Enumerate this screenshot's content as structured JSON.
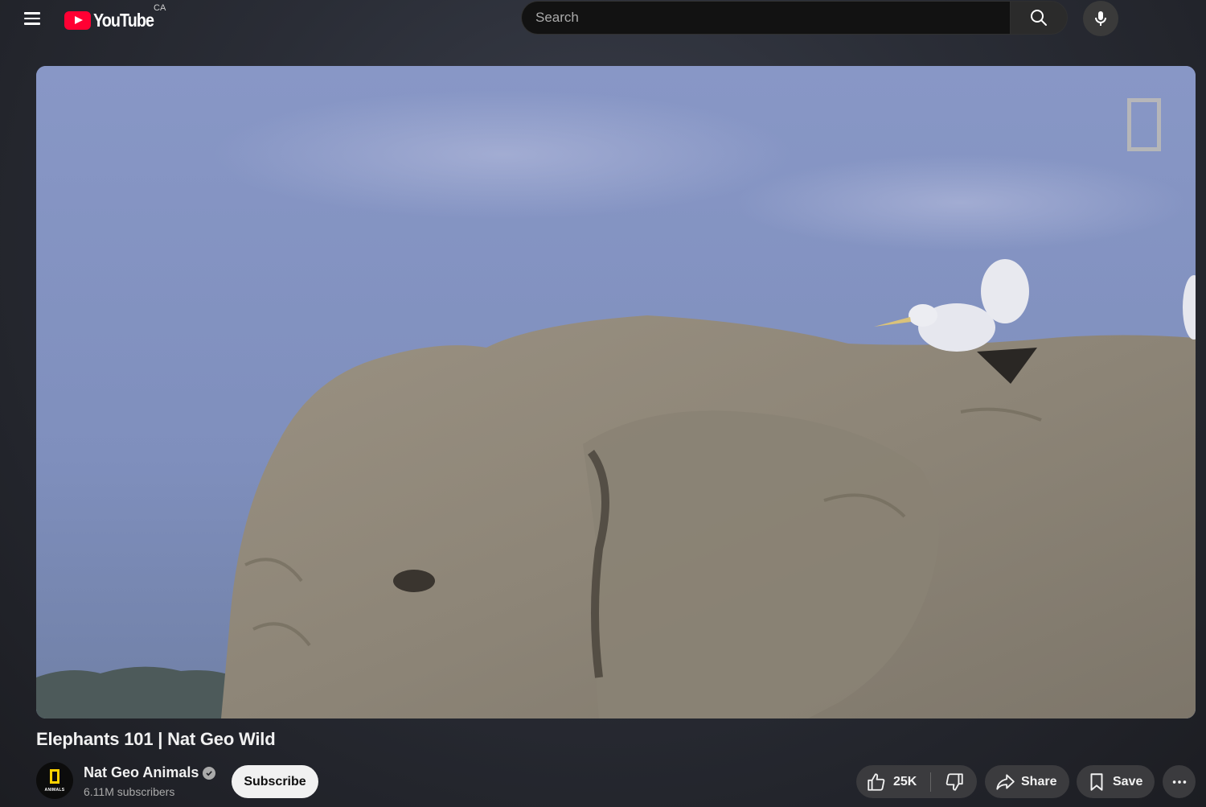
{
  "header": {
    "logo_text": "YouTube",
    "country_code": "CA",
    "search_placeholder": "Search"
  },
  "video": {
    "title": "Elephants 101 | Nat Geo Wild"
  },
  "channel": {
    "name": "Nat Geo Animals",
    "avatar_text": "ANIMALS",
    "subscribers": "6.11M subscribers",
    "subscribe_label": "Subscribe"
  },
  "actions": {
    "like_count": "25K",
    "share_label": "Share",
    "save_label": "Save"
  },
  "icons": {
    "menu": "menu-icon",
    "search": "search-icon",
    "mic": "mic-icon",
    "verified": "verified-check-icon",
    "like": "thumbs-up-icon",
    "dislike": "thumbs-down-icon",
    "share": "share-arrow-icon",
    "save": "bookmark-icon",
    "more": "more-horizontal-icon"
  },
  "colors": {
    "brand_red": "#ff0033",
    "background": "#2a2d36",
    "button_bg": "#3b3b3e",
    "subscribe_bg": "#f1f1f1"
  }
}
